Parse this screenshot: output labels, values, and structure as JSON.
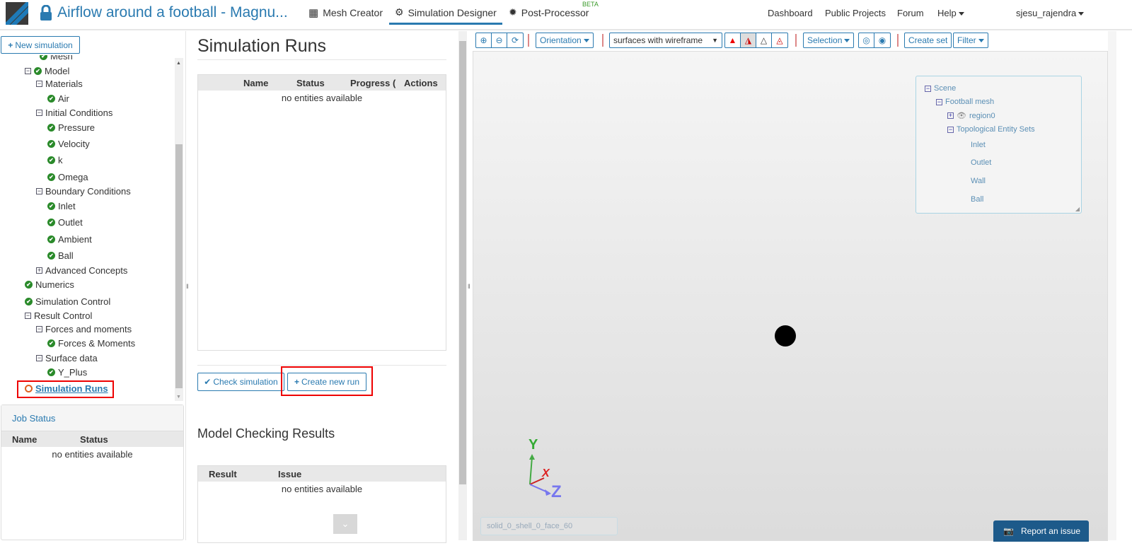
{
  "header": {
    "title": "Airflow around a football - Magnu...",
    "nav": [
      {
        "label": "Mesh Creator",
        "icon": "grid-icon"
      },
      {
        "label": "Simulation Designer",
        "icon": "gears-icon",
        "active": true
      },
      {
        "label": "Post-Processor",
        "icon": "cog-icon",
        "badge": "BETA"
      }
    ],
    "right_nav": [
      "Dashboard",
      "Public Projects",
      "Forum",
      "Help"
    ],
    "user": "sjesu_rajendra"
  },
  "left": {
    "new_simulation": "New simulation",
    "tree": [
      {
        "label": "Mesh",
        "level": 2,
        "icon": "check"
      },
      {
        "label": "Model",
        "level": 1,
        "icon": "minus-check"
      },
      {
        "label": "Materials",
        "level": 2,
        "icon": "minus"
      },
      {
        "label": "Air",
        "level": 3,
        "icon": "check"
      },
      {
        "label": "Initial Conditions",
        "level": 2,
        "icon": "minus"
      },
      {
        "label": "Pressure",
        "level": 3,
        "icon": "check"
      },
      {
        "label": "Velocity",
        "level": 3,
        "icon": "check"
      },
      {
        "label": "k",
        "level": 3,
        "icon": "check"
      },
      {
        "label": "Omega",
        "level": 3,
        "icon": "check"
      },
      {
        "label": "Boundary Conditions",
        "level": 2,
        "icon": "minus"
      },
      {
        "label": "Inlet",
        "level": 3,
        "icon": "check"
      },
      {
        "label": "Outlet",
        "level": 3,
        "icon": "check"
      },
      {
        "label": "Ambient",
        "level": 3,
        "icon": "check"
      },
      {
        "label": "Ball",
        "level": 3,
        "icon": "check"
      },
      {
        "label": "Advanced Concepts",
        "level": 2,
        "icon": "plus"
      },
      {
        "label": "Numerics",
        "level": 1,
        "icon": "check"
      },
      {
        "label": "Simulation Control",
        "level": 1,
        "icon": "check"
      },
      {
        "label": "Result Control",
        "level": 1,
        "icon": "minus"
      },
      {
        "label": "Forces and moments",
        "level": 2,
        "icon": "minus"
      },
      {
        "label": "Forces & Moments",
        "level": 3,
        "icon": "check"
      },
      {
        "label": "Surface data",
        "level": 2,
        "icon": "minus"
      },
      {
        "label": "Y_Plus",
        "level": 3,
        "icon": "check"
      },
      {
        "label": "Simulation Runs",
        "level": 1,
        "icon": "circle",
        "selected": true
      }
    ],
    "job_status": {
      "title": "Job Status",
      "columns": [
        "Name",
        "Status"
      ],
      "empty": "no entities available"
    }
  },
  "middle": {
    "title": "Simulation Runs",
    "runs_table": {
      "columns": [
        "Name",
        "Status",
        "Progress (",
        "Actions"
      ],
      "empty": "no entities available"
    },
    "check_button": "Check simulation",
    "create_button": "Create new run",
    "model_checking": {
      "title": "Model Checking Results",
      "columns": [
        "Result",
        "Issue"
      ],
      "empty": "no entities available"
    }
  },
  "viewer": {
    "orientation": "Orientation",
    "render_mode": "surfaces with wireframe",
    "selection": "Selection",
    "create_set": "Create set",
    "filter": "Filter",
    "scene_tree": {
      "scene": "Scene",
      "mesh": "Football mesh",
      "region": "region0",
      "sets_label": "Topological Entity Sets",
      "sets": [
        "Inlet",
        "Outlet",
        "Wall",
        "Ball"
      ]
    },
    "axes": {
      "x": "X",
      "y": "Y",
      "z": "Z"
    },
    "selected_face": "solid_0_shell_0_face_60",
    "report": "Report an issue"
  },
  "colors": {
    "accent": "#2a7ab0",
    "check": "#2a8a2a",
    "highlight": "#e00000"
  }
}
